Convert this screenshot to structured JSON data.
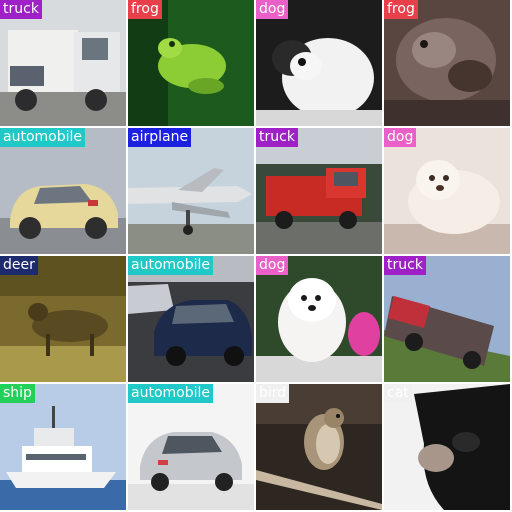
{
  "classes": {
    "truck": {
      "color": "#a020c8"
    },
    "frog": {
      "color": "#e8404a"
    },
    "dog": {
      "color": "#e860c8"
    },
    "automobile": {
      "color": "#20c8c8"
    },
    "airplane": {
      "color": "#1c20e0"
    },
    "deer": {
      "color": "#1e2a6e"
    },
    "ship": {
      "color": "#22d05a"
    },
    "bird": {
      "color": "#f0f0f0"
    },
    "cat": {
      "color": "#f0f0f0"
    }
  },
  "tiles": [
    {
      "label": "truck",
      "class": "truck"
    },
    {
      "label": "frog",
      "class": "frog"
    },
    {
      "label": "dog",
      "class": "dog"
    },
    {
      "label": "frog",
      "class": "frog"
    },
    {
      "label": "automobile",
      "class": "automobile"
    },
    {
      "label": "airplane",
      "class": "airplane"
    },
    {
      "label": "truck",
      "class": "truck"
    },
    {
      "label": "dog",
      "class": "dog"
    },
    {
      "label": "deer",
      "class": "deer"
    },
    {
      "label": "automobile",
      "class": "automobile"
    },
    {
      "label": "dog",
      "class": "dog"
    },
    {
      "label": "truck",
      "class": "truck"
    },
    {
      "label": "ship",
      "class": "ship"
    },
    {
      "label": "automobile",
      "class": "automobile"
    },
    {
      "label": "bird",
      "class": "bird"
    },
    {
      "label": "cat",
      "class": "cat"
    }
  ]
}
